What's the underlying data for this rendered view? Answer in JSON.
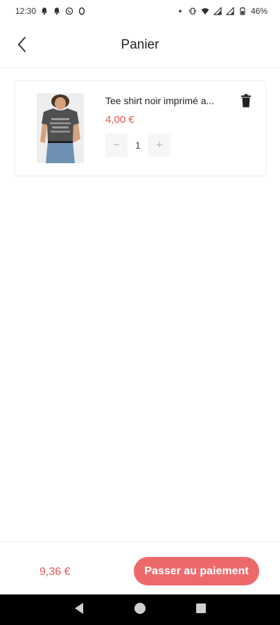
{
  "status_bar": {
    "time": "12:30",
    "battery": "46%",
    "left_icons": [
      "bell-icon",
      "bell-icon",
      "whatsapp-icon",
      "o-app-icon"
    ],
    "right_icons": [
      "dot-icon",
      "vibrate-icon",
      "wifi-icon",
      "signal-icon",
      "signal-icon",
      "battery-icon"
    ]
  },
  "header": {
    "title": "Panier",
    "back_icon": "chevron-left-icon"
  },
  "cart": {
    "items": [
      {
        "name": "Tee shirt noir imprimé a...",
        "price": "4,00 €",
        "quantity": "1",
        "minus_label": "−",
        "plus_label": "+",
        "delete_icon": "trash-icon"
      }
    ]
  },
  "footer": {
    "total": "9,36 €",
    "checkout_label": "Passer au paiement"
  },
  "colors": {
    "accent": "#ee6a6a",
    "price": "#e65555",
    "divider": "#ececec"
  },
  "navigation": {
    "icons": [
      "back-triangle-icon",
      "home-circle-icon",
      "recents-square-icon"
    ]
  }
}
